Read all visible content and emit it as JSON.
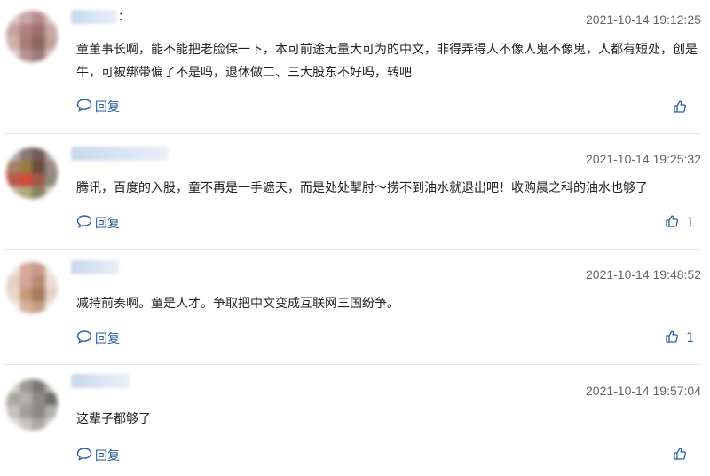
{
  "comments": [
    {
      "time": "2021-10-14 19:12:25",
      "text": "童董事长啊，能不能把老脸保一下，本可前途无量大可为的中文，非得弄得人不像人鬼不像鬼，人都有短处，创是牛，可被绑带偏了不是吗，退休做二、三大股东不好吗，转吧",
      "reply_label": "回复",
      "likes": "",
      "colon": "："
    },
    {
      "time": "2021-10-14 19:25:32",
      "text": "腾讯，百度的入股，童不再是一手遮天，而是处处掣肘～捞不到油水就退出吧！收购晨之科的油水也够了",
      "reply_label": "回复",
      "likes": "1",
      "colon": ""
    },
    {
      "time": "2021-10-14 19:48:52",
      "text": "减持前奏啊。童是人才。争取把中文变成互联网三国纷争。",
      "reply_label": "回复",
      "likes": "1",
      "colon": ""
    },
    {
      "time": "2021-10-14 19:57:04",
      "text": "这辈子都够了",
      "reply_label": "回复",
      "likes": "",
      "colon": ""
    }
  ],
  "colors": {
    "link": "#2a5d9c",
    "time": "#666666",
    "divider": "#e8e8e8"
  }
}
